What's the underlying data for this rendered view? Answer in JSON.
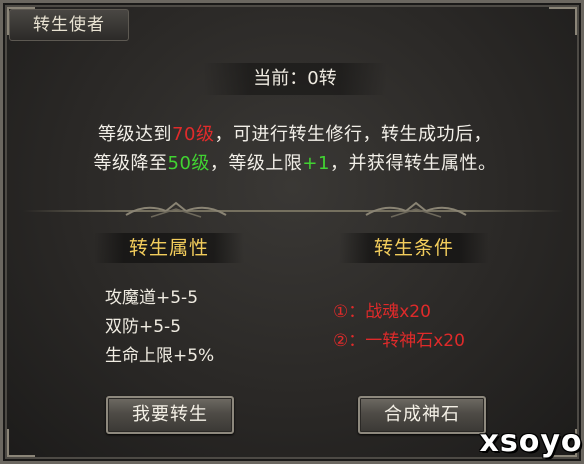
{
  "window": {
    "title": "转生使者"
  },
  "status": {
    "text": "当前：0转"
  },
  "description": {
    "line1": {
      "pre": "等级达到",
      "level": "70级",
      "post": "，可进行转生修行，转生成功后，"
    },
    "line2": {
      "pre": "等级降至",
      "level": "50级",
      "mid": "，等级上限",
      "bonus": "+1",
      "post": "，并获得转生属性。"
    }
  },
  "attributes": {
    "header": "转生属性",
    "items": [
      "攻魔道+5-5",
      "双防+5-5",
      "生命上限+5%"
    ]
  },
  "conditions": {
    "header": "转生条件",
    "items": [
      "①：战魂x20",
      "②：一转神石x20"
    ]
  },
  "buttons": {
    "rebirth": "我要转生",
    "synthesize": "合成神石"
  },
  "watermark": {
    "text": "xsoyo"
  },
  "colors": {
    "header_gold": "#f3cd5c",
    "condition_red": "#df2a2a",
    "highlight_red": "#e02b2b",
    "highlight_green": "#41d332"
  }
}
